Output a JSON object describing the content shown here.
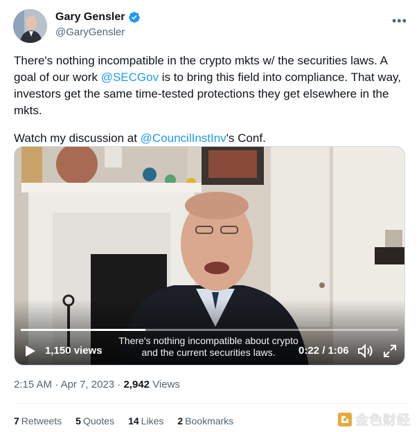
{
  "author": {
    "name": "Gary Gensler",
    "handle": "@GaryGensler",
    "verified": true
  },
  "tweet": {
    "line1_pre": "There's nothing incompatible in the crypto mkts w/ the securities laws. A goal of our work ",
    "mention1": "@SECGov",
    "line1_post": " is to bring this field into compliance. That way, investors get the same time-tested protections they get elsewhere in the mkts.",
    "line2_pre": "Watch my discussion at ",
    "mention2": "@CouncilInstInv",
    "line2_post": "'s Conf."
  },
  "video": {
    "views": "1,150 views",
    "caption_line1": "There's nothing incompatible about crypto",
    "caption_line2": "and the current securities laws.",
    "time": "0:22 / 1:06",
    "progress_fraction": 0.33
  },
  "meta": {
    "time": "2:15 AM",
    "date": "Apr 7, 2023",
    "views_count": "2,942",
    "views_label": "Views"
  },
  "stats": {
    "retweets_count": "7",
    "retweets_label": "Retweets",
    "quotes_count": "5",
    "quotes_label": "Quotes",
    "likes_count": "14",
    "likes_label": "Likes",
    "bookmarks_count": "2",
    "bookmarks_label": "Bookmarks"
  },
  "watermark": {
    "text": "金色财经"
  },
  "colors": {
    "link": "#1d9bf0",
    "verified": "#1d9bf0",
    "muted": "#536471",
    "text": "#0f1419",
    "watermark_gold": "#e9a93a"
  }
}
